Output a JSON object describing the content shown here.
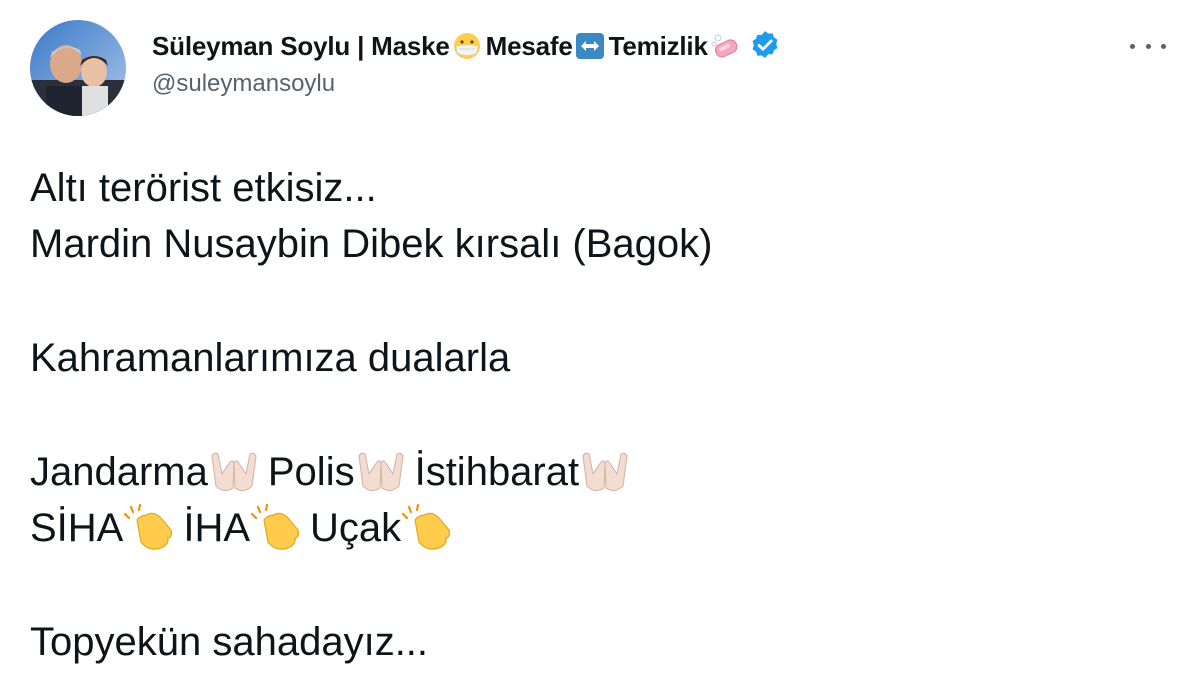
{
  "author": {
    "name_part1": "Süleyman Soylu | Maske",
    "name_part2": "Mesafe",
    "name_part3": "Temizlik",
    "handle": "@suleymansoylu"
  },
  "icons": {
    "mask": "face-with-medical-mask-icon",
    "arrow": "left-right-arrow-icon",
    "soap": "soap-icon",
    "verified": "verified-badge-icon",
    "praying": "palms-up-together-icon",
    "clapping": "clapping-hands-icon"
  },
  "colors": {
    "verified": "#1d9bf0",
    "handle": "#536471",
    "text": "#0f1419"
  },
  "tweet": {
    "line1": "Altı terörist etkisiz...",
    "line2": "Mardin Nusaybin Dibek kırsalı (Bagok)",
    "line3": "Kahramanlarımıza dualarla",
    "line4_a": "Jandarma",
    "line4_b": "Polis",
    "line4_c": "İstihbarat",
    "line5_a": "SİHA",
    "line5_b": "İHA",
    "line5_c": "Uçak",
    "line6": "Topyekün sahadayız..."
  }
}
